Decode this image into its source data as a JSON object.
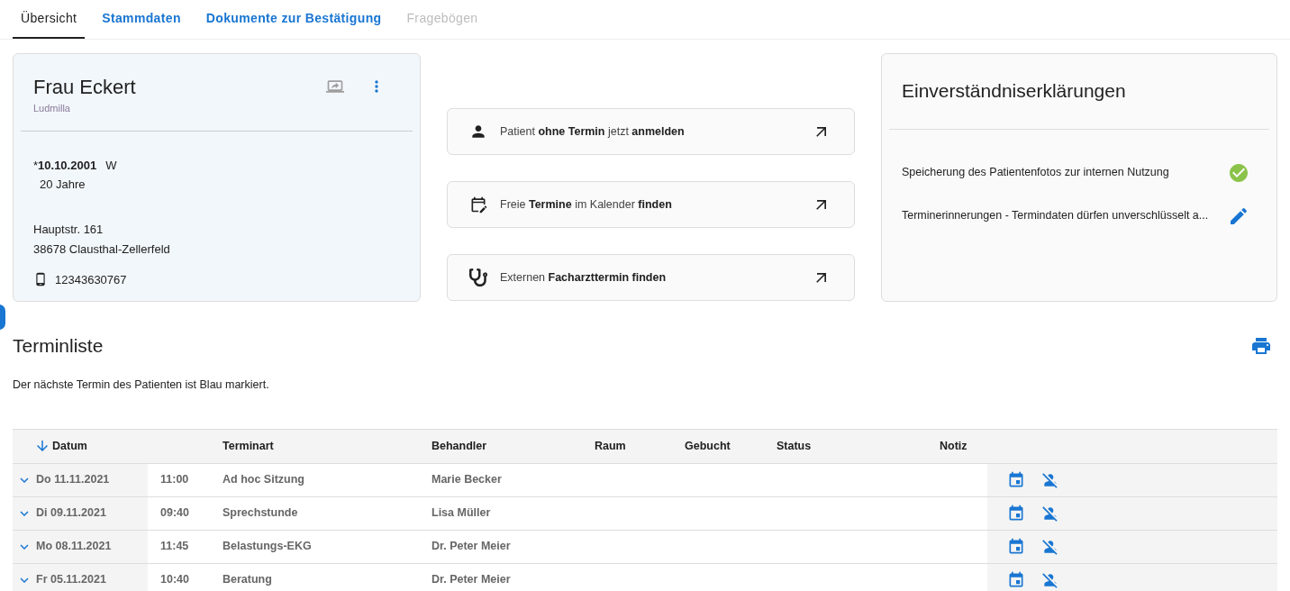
{
  "tabs": [
    {
      "label": "Übersicht",
      "selected": true,
      "disabled": false
    },
    {
      "label": "Stammdaten",
      "selected": false,
      "disabled": false
    },
    {
      "label": "Dokumente zur Bestätigung",
      "selected": false,
      "disabled": false
    },
    {
      "label": "Fragebögen",
      "selected": false,
      "disabled": true
    }
  ],
  "patient": {
    "name": "Frau Eckert",
    "first_name": "Ludmilla",
    "birth_mark": "*",
    "birth_date": "10.10.2001",
    "sex": "W",
    "age": "20 Jahre",
    "street": "Hauptstr. 161",
    "city": "38678 Clausthal-Zellerfeld",
    "phone": "12343630767"
  },
  "actions": [
    {
      "kind": "person",
      "text": "Patient **ohne Termin** jetzt **anmelden**"
    },
    {
      "kind": "calendar",
      "text": "Freie **Termine** im Kalender **finden**"
    },
    {
      "kind": "stethoscope",
      "text": "Externen **Facharzttermin finden**"
    }
  ],
  "consents": {
    "title": "Einverständniserklärungen",
    "items": [
      {
        "kind": "granted",
        "text": "Speicherung des Patientenfotos zur internen Nutzung"
      },
      {
        "kind": "edit",
        "text": "Terminerinnerungen - Termindaten dürfen unverschlüsselt a..."
      }
    ]
  },
  "appointments": {
    "title": "Terminliste",
    "hint": "Der nächste Termin des Patienten ist Blau markiert.",
    "columns": [
      "Datum",
      "Terminart",
      "Behandler",
      "Raum",
      "Gebucht",
      "Status",
      "Notiz"
    ],
    "rows": [
      {
        "date": "Do 11.11.2021",
        "time": "11:00",
        "type": "Ad hoc Sitzung",
        "doctor": "Marie Becker"
      },
      {
        "date": "Di 09.11.2021",
        "time": "09:40",
        "type": "Sprechstunde",
        "doctor": "Lisa Müller"
      },
      {
        "date": "Mo 08.11.2021",
        "time": "11:45",
        "type": "Belastungs-EKG",
        "doctor": "Dr. Peter Meier"
      },
      {
        "date": "Fr 05.11.2021",
        "time": "10:40",
        "type": "Beratung",
        "doctor": "Dr. Peter Meier"
      }
    ]
  }
}
